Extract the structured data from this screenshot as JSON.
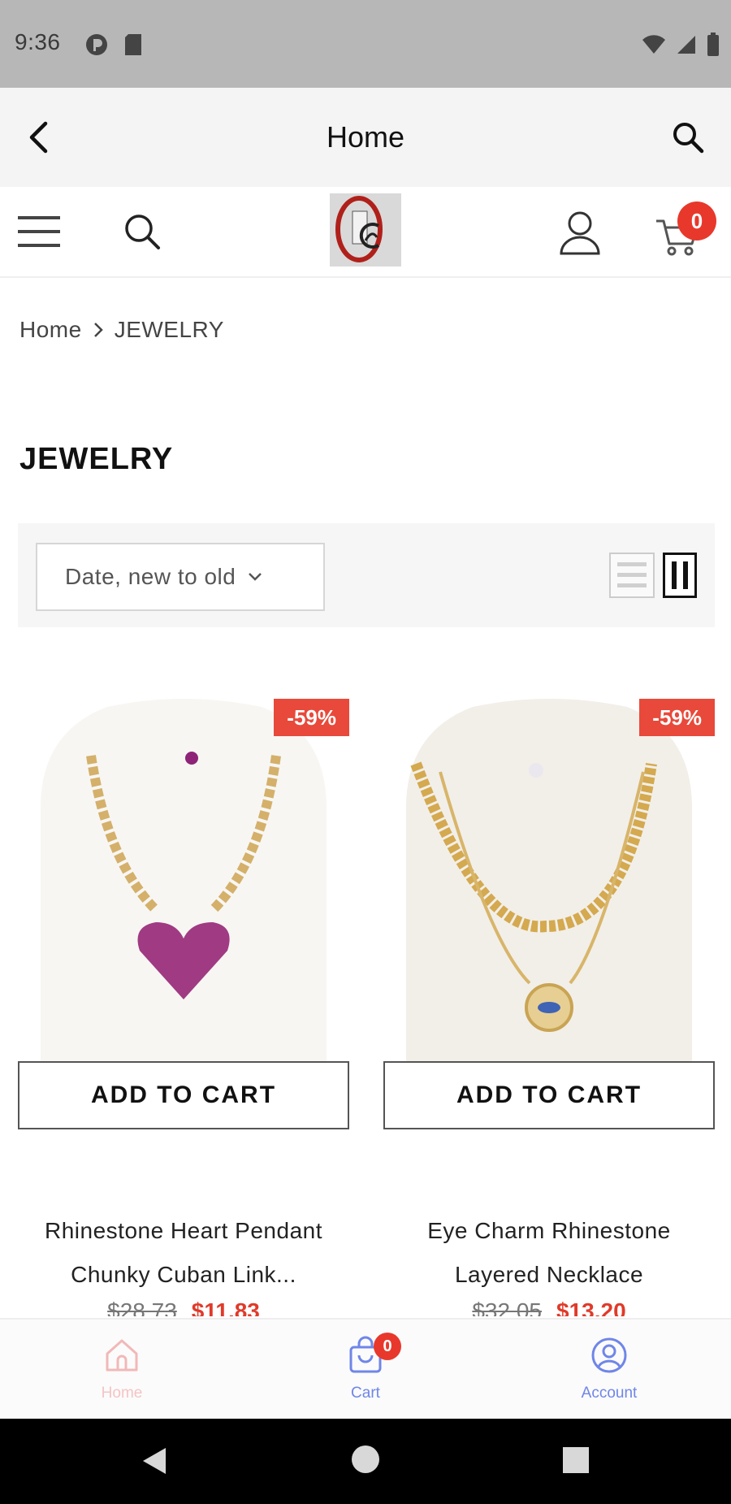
{
  "status_bar": {
    "time": "9:36"
  },
  "app_bar": {
    "title": "Home"
  },
  "header": {
    "cart_count": "0"
  },
  "breadcrumb": {
    "home": "Home",
    "current": "JEWELRY"
  },
  "page": {
    "title": "JEWELRY"
  },
  "toolbar": {
    "sort_value": "Date, new to old"
  },
  "products": [
    {
      "name": "Rhinestone Heart Pendant Chunky Cuban Link...",
      "discount": "-59%",
      "add_to_cart": "ADD TO CART",
      "old_price": "$28.73",
      "new_price": "$11.83"
    },
    {
      "name": "Eye Charm Rhinestone Layered Necklace",
      "discount": "-59%",
      "add_to_cart": "ADD TO CART",
      "old_price": "$32.05",
      "new_price": "$13.20"
    }
  ],
  "bottom_nav": {
    "home": "Home",
    "cart": "Cart",
    "cart_badge": "0",
    "account": "Account"
  },
  "colors": {
    "accent_red": "#e8382c",
    "nav_blue": "#6f86e8",
    "nav_home_faded": "#f2b8b8"
  }
}
